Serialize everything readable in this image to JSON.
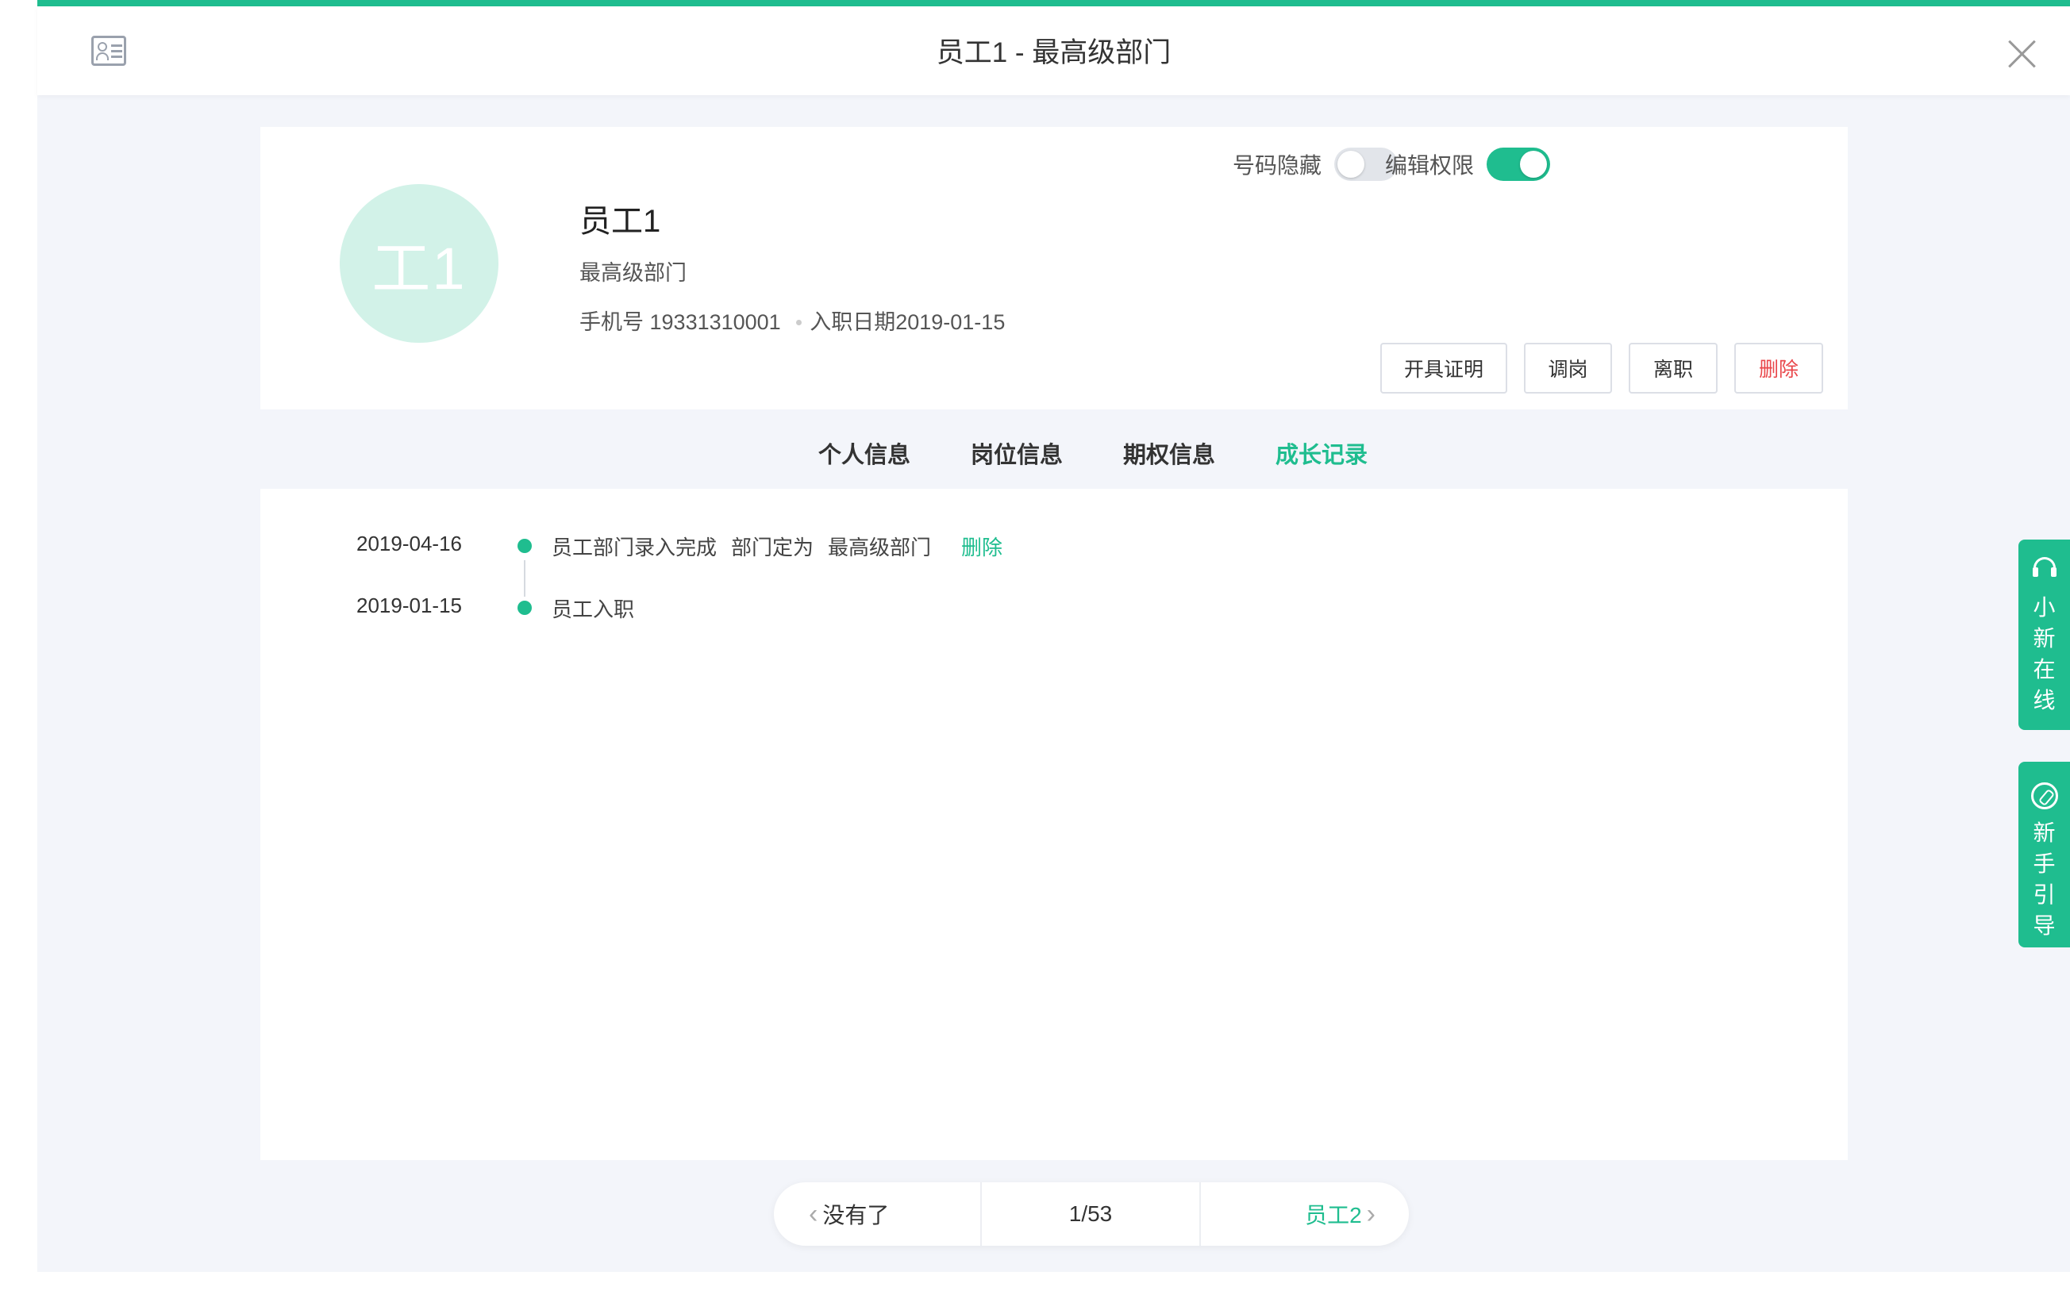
{
  "header": {
    "title": "员工1 - 最高级部门"
  },
  "profile": {
    "avatar_text": "工1",
    "name": "员工1",
    "department": "最高级部门",
    "phone_label": "手机号",
    "phone": "19331310001",
    "join_label": "入职日期",
    "join_date": "2019-01-15",
    "toggles": [
      {
        "label": "号码隐藏",
        "state": "off"
      },
      {
        "label": "编辑权限",
        "state": "on"
      }
    ],
    "actions": [
      {
        "label": "开具证明"
      },
      {
        "label": "调岗"
      },
      {
        "label": "离职"
      },
      {
        "label": "删除",
        "color": "#e9474b"
      }
    ]
  },
  "tabs": [
    {
      "label": "个人信息",
      "active": false
    },
    {
      "label": "岗位信息",
      "active": false
    },
    {
      "label": "期权信息",
      "active": false
    },
    {
      "label": "成长记录",
      "active": true
    }
  ],
  "timeline": [
    {
      "date": "2019-04-16",
      "event": "员工部门录入完成",
      "field": "部门定为",
      "value": "最高级部门",
      "delete_label": "删除"
    },
    {
      "date": "2019-01-15",
      "event": "员工入职"
    }
  ],
  "pager": {
    "prev_label": "没有了",
    "position": "1/53",
    "next_label": "员工2"
  },
  "side": {
    "online_label": "小新在线",
    "guide_label": "新手引导"
  },
  "colors": {
    "accent": "#1fbd8f",
    "danger": "#e9474b",
    "avatar_bg": "#d2f2e8"
  }
}
